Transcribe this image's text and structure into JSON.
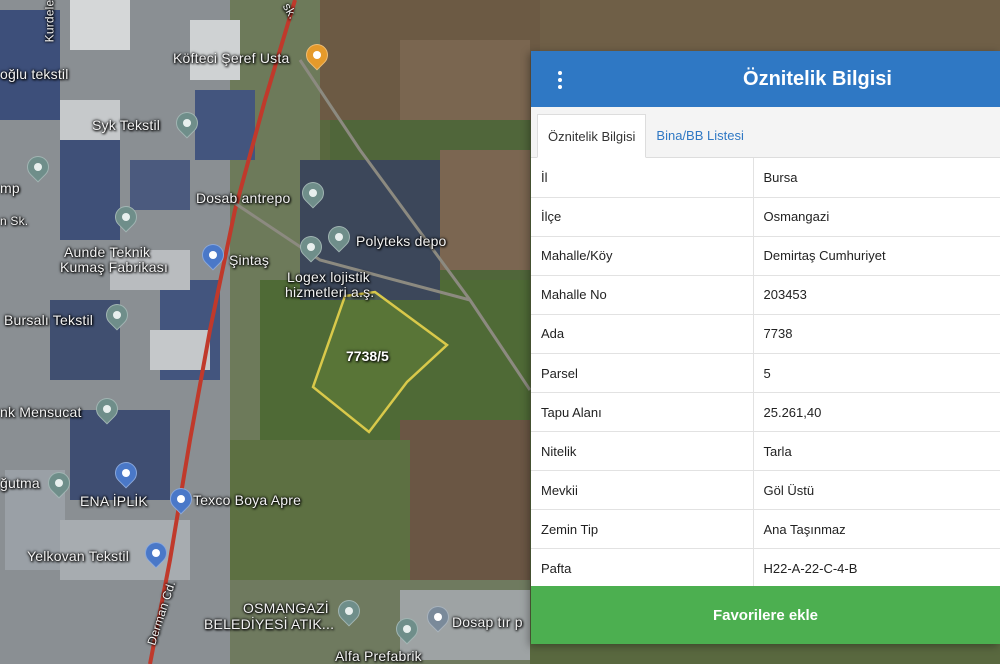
{
  "map": {
    "parcel_label": "7738/5",
    "places": [
      {
        "id": "kofteci",
        "label": "Köfteci Şeref Usta"
      },
      {
        "id": "oglu",
        "label": "oğlu tekstil"
      },
      {
        "id": "syk",
        "label": "Syk Tekstil"
      },
      {
        "id": "dosab",
        "label": "Dosab antrepo"
      },
      {
        "id": "polyteks",
        "label": "Polyteks depo"
      },
      {
        "id": "aunde1",
        "label": "Aunde Teknik"
      },
      {
        "id": "aunde2",
        "label": "Kumaş Fabrikası"
      },
      {
        "id": "sintas",
        "label": "Şintaş"
      },
      {
        "id": "logex1",
        "label": "Logex lojistik"
      },
      {
        "id": "logex2",
        "label": "hizmetleri a.ş."
      },
      {
        "id": "bursali",
        "label": "Bursalı Tekstil"
      },
      {
        "id": "mensucat",
        "label": "nk Mensucat"
      },
      {
        "id": "orgutme",
        "label": "ğutma"
      },
      {
        "id": "enaiplik",
        "label": "ENA İPLİK"
      },
      {
        "id": "texco",
        "label": "Texco Boya Apre"
      },
      {
        "id": "yelkovan",
        "label": "Yelkovan Tekstil"
      },
      {
        "id": "osmangazi1",
        "label": "OSMANGAZİ"
      },
      {
        "id": "osmangazi2",
        "label": "BELEDİYESİ ATIK..."
      },
      {
        "id": "dosaptir",
        "label": "Dosap tır p"
      },
      {
        "id": "alfa",
        "label": "Alfa Prefabrik"
      },
      {
        "id": "dermancd",
        "label": "Derman Cd."
      },
      {
        "id": "kurdele",
        "label": "Kurdele"
      },
      {
        "id": "amp",
        "label": "mp"
      },
      {
        "id": "nsk",
        "label": "n Sk."
      },
      {
        "id": "sk_top",
        "label": "sk."
      }
    ]
  },
  "panel": {
    "title": "Öznitelik Bilgisi",
    "menu_icon": "more-vertical-icon",
    "tabs": [
      {
        "label": "Öznitelik Bilgisi",
        "active": true
      },
      {
        "label": "Bina/BB Listesi",
        "active": false
      }
    ],
    "rows": [
      {
        "key": "İl",
        "value": "Bursa"
      },
      {
        "key": "İlçe",
        "value": "Osmangazi"
      },
      {
        "key": "Mahalle/Köy",
        "value": "Demirtaş Cumhuriyet"
      },
      {
        "key": "Mahalle No",
        "value": "203453"
      },
      {
        "key": "Ada",
        "value": "7738"
      },
      {
        "key": "Parsel",
        "value": "5"
      },
      {
        "key": "Tapu Alanı",
        "value": "25.261,40"
      },
      {
        "key": "Nitelik",
        "value": "Tarla"
      },
      {
        "key": "Mevkii",
        "value": "Göl Üstü"
      },
      {
        "key": "Zemin Tip",
        "value": "Ana Taşınmaz"
      },
      {
        "key": "Pafta",
        "value": "H22-A-22-C-4-B"
      }
    ],
    "favorite_button": "Favorilere ekle"
  },
  "colors": {
    "header": "#2f78c4",
    "button": "#4caf50",
    "parcel_outline": "#d9c94a",
    "road": "#c0392b"
  }
}
